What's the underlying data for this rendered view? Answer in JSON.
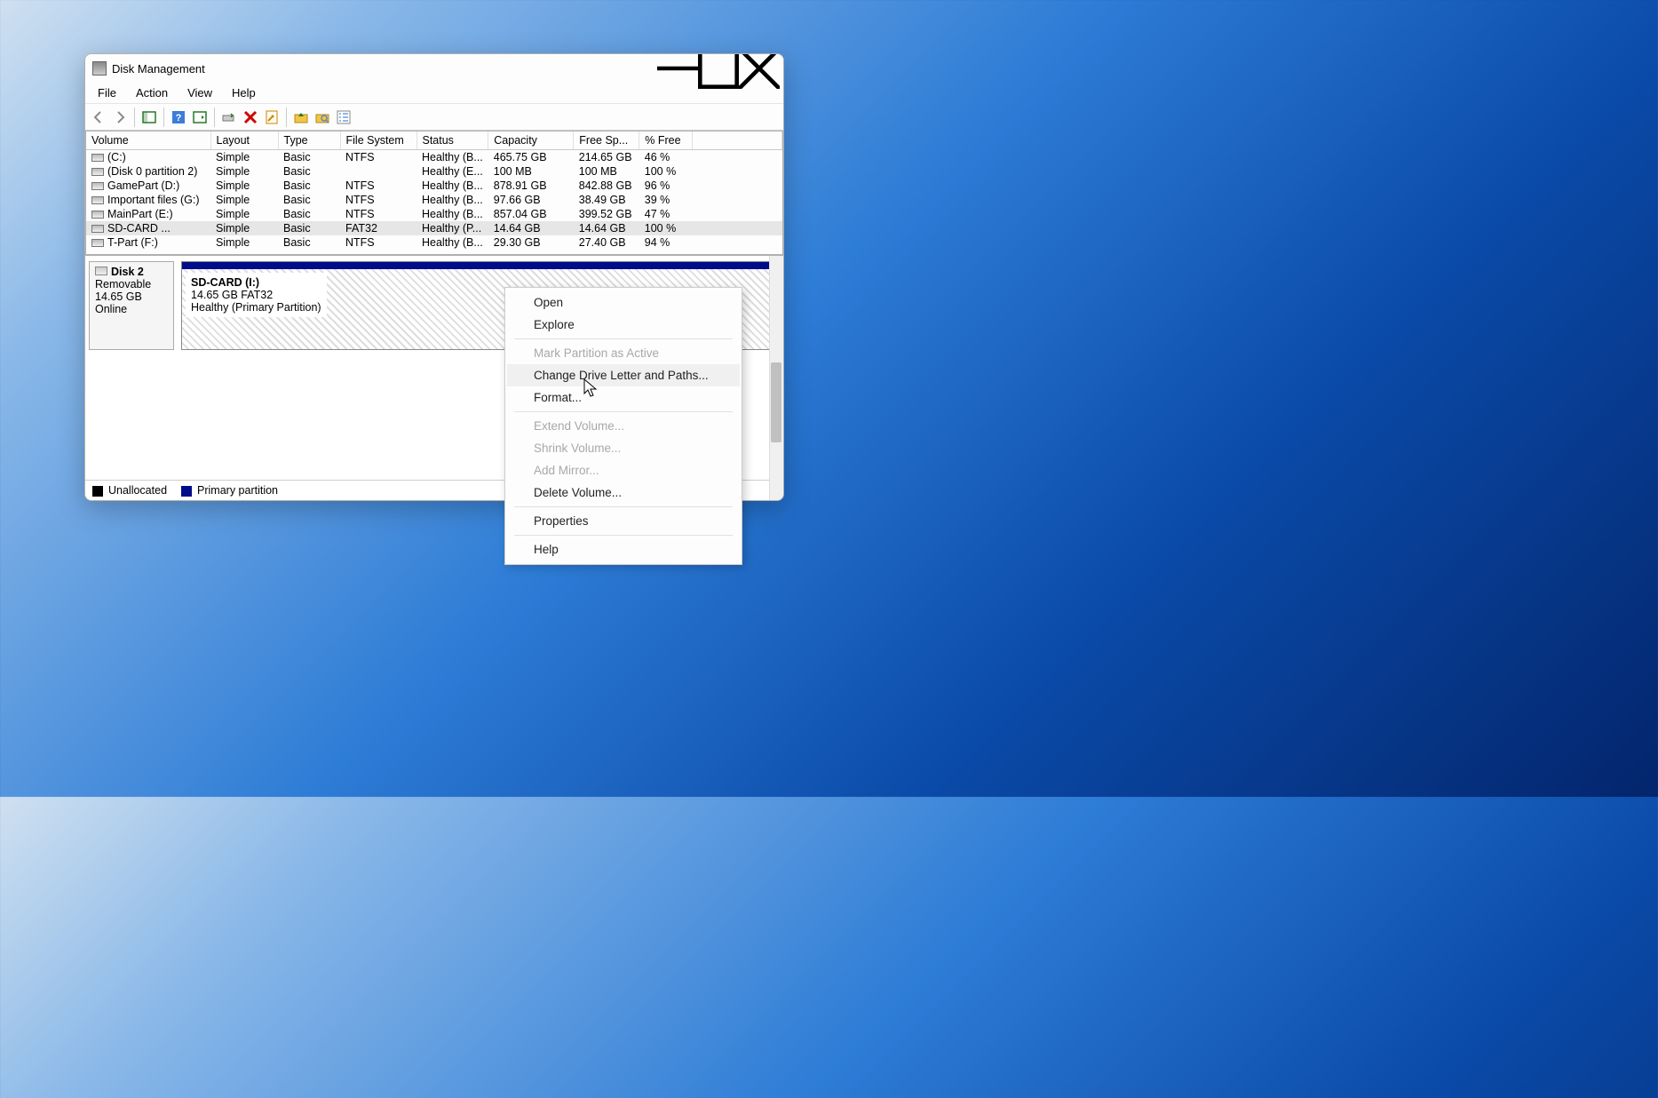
{
  "window": {
    "title": "Disk Management"
  },
  "menubar": {
    "file": "File",
    "action": "Action",
    "view": "View",
    "help": "Help"
  },
  "table": {
    "headers": {
      "volume": "Volume",
      "layout": "Layout",
      "type": "Type",
      "filesystem": "File System",
      "status": "Status",
      "capacity": "Capacity",
      "freespace": "Free Sp...",
      "pctfree": "% Free"
    },
    "rows": [
      {
        "volume": "(C:)",
        "layout": "Simple",
        "type": "Basic",
        "fs": "NTFS",
        "status": "Healthy (B...",
        "capacity": "465.75 GB",
        "free": "214.65 GB",
        "pct": "46 %"
      },
      {
        "volume": "(Disk 0 partition 2)",
        "layout": "Simple",
        "type": "Basic",
        "fs": "",
        "status": "Healthy (E...",
        "capacity": "100 MB",
        "free": "100 MB",
        "pct": "100 %"
      },
      {
        "volume": "GamePart (D:)",
        "layout": "Simple",
        "type": "Basic",
        "fs": "NTFS",
        "status": "Healthy (B...",
        "capacity": "878.91 GB",
        "free": "842.88 GB",
        "pct": "96 %"
      },
      {
        "volume": "Important files (G:)",
        "layout": "Simple",
        "type": "Basic",
        "fs": "NTFS",
        "status": "Healthy (B...",
        "capacity": "97.66 GB",
        "free": "38.49 GB",
        "pct": "39 %"
      },
      {
        "volume": "MainPart (E:)",
        "layout": "Simple",
        "type": "Basic",
        "fs": "NTFS",
        "status": "Healthy (B...",
        "capacity": "857.04 GB",
        "free": "399.52 GB",
        "pct": "47 %"
      },
      {
        "volume": "SD-CARD ...",
        "layout": "Simple",
        "type": "Basic",
        "fs": "FAT32",
        "status": "Healthy (P...",
        "capacity": "14.64 GB",
        "free": "14.64 GB",
        "pct": "100 %"
      },
      {
        "volume": "T-Part (F:)",
        "layout": "Simple",
        "type": "Basic",
        "fs": "NTFS",
        "status": "Healthy (B...",
        "capacity": "29.30 GB",
        "free": "27.40 GB",
        "pct": "94 %"
      }
    ]
  },
  "disk": {
    "name": "Disk 2",
    "media": "Removable",
    "size": "14.65 GB",
    "state": "Online"
  },
  "partition": {
    "name": "SD-CARD  (I:)",
    "info": "14.65 GB FAT32",
    "status": "Healthy (Primary Partition)"
  },
  "legend": {
    "unallocated": "Unallocated",
    "primary": "Primary partition"
  },
  "context_menu": {
    "open": "Open",
    "explore": "Explore",
    "mark_active": "Mark Partition as Active",
    "change_letter": "Change Drive Letter and Paths...",
    "format": "Format...",
    "extend": "Extend Volume...",
    "shrink": "Shrink Volume...",
    "add_mirror": "Add Mirror...",
    "delete": "Delete Volume...",
    "properties": "Properties",
    "help": "Help"
  }
}
